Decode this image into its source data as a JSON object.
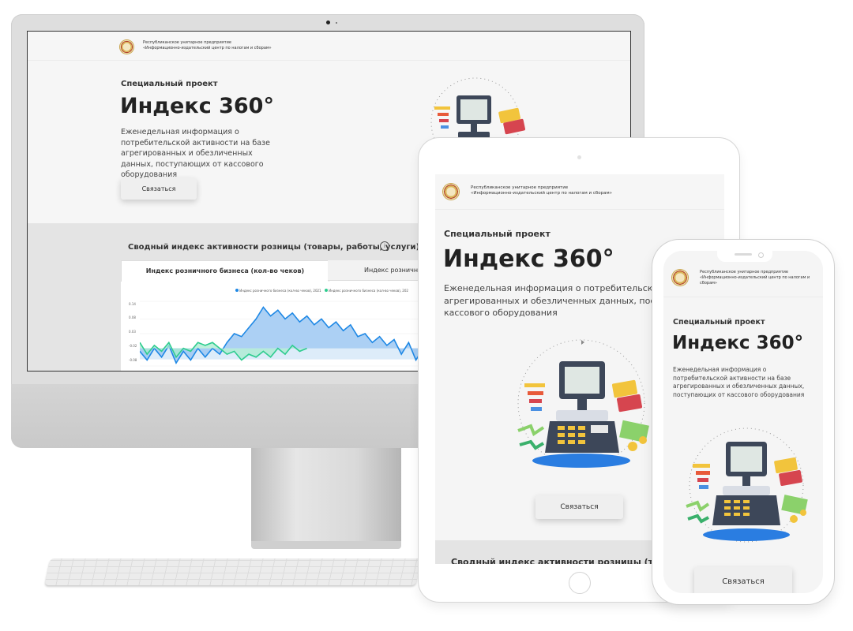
{
  "org": {
    "line1": "Республиканское унитарное предприятие",
    "line2": "«Информационно-издательский центр по налогам и сборам»"
  },
  "hero": {
    "kicker": "Специальный проект",
    "title": "Индекс 360°",
    "desc_desktop": "Еженедельная информация о потребительской активности на базе агрегированных и обезличенных данных, поступающих от кассового оборудования",
    "desc_tablet_1": "Еженедельная информация о потребительской актив",
    "desc_tablet_2": "агрегированных и обезличенных данных, поступаю",
    "desc_tablet_3": "кассового оборудования",
    "button": "Связаться"
  },
  "index_section": {
    "heading": "Сводный индекс активности розницы (товары, работы, услуги)",
    "heading_tablet": "Сводный индекс активности розницы (това",
    "info_icon": "info-circle-icon",
    "tabs": [
      "Индекс розничного бизнеса (кол-во чеков)",
      "Индекс розничного"
    ],
    "legend": [
      "Индекс розничного бизнеса (кол-во чеков), 2021",
      "Индекс розничного бизнеса (кол-во чеков), 202"
    ]
  },
  "chart_data": {
    "type": "area",
    "yticks": [
      "0.14",
      "0.08",
      "0.03",
      "-0.02",
      "-0.08"
    ],
    "ylim": [
      -0.08,
      0.14
    ],
    "series": [
      {
        "name": "Индекс розничного бизнеса (кол-во чеков), 2021",
        "color": "#1e88e5",
        "values": [
          -0.03,
          -0.06,
          -0.02,
          -0.05,
          -0.01,
          -0.07,
          -0.03,
          -0.06,
          -0.02,
          -0.05,
          -0.02,
          -0.04,
          0.0,
          0.03,
          0.02,
          0.05,
          0.08,
          0.12,
          0.09,
          0.11,
          0.08,
          0.1,
          0.07,
          0.09,
          0.06,
          0.08,
          0.05,
          0.07,
          0.04,
          0.06,
          0.02,
          0.03,
          0.0,
          0.02,
          -0.01,
          0.01,
          -0.04,
          0.0,
          -0.06,
          -0.02,
          -0.08,
          -0.03,
          -0.05,
          -0.02,
          -0.04,
          -0.08
        ]
      },
      {
        "name": "Индекс розничного бизнеса (кол-во чеков), 202",
        "color": "#2ecc8f",
        "values": [
          0.0,
          -0.04,
          -0.01,
          -0.03,
          0.0,
          -0.05,
          -0.02,
          -0.03,
          0.0,
          -0.01,
          0.0,
          -0.02,
          -0.04,
          -0.03,
          -0.06,
          -0.04,
          -0.05,
          -0.03,
          -0.05,
          -0.02,
          -0.04,
          -0.01,
          -0.03,
          -0.02
        ]
      }
    ],
    "colors": {
      "blue": "#1e88e5",
      "green": "#2ecc8f"
    }
  }
}
